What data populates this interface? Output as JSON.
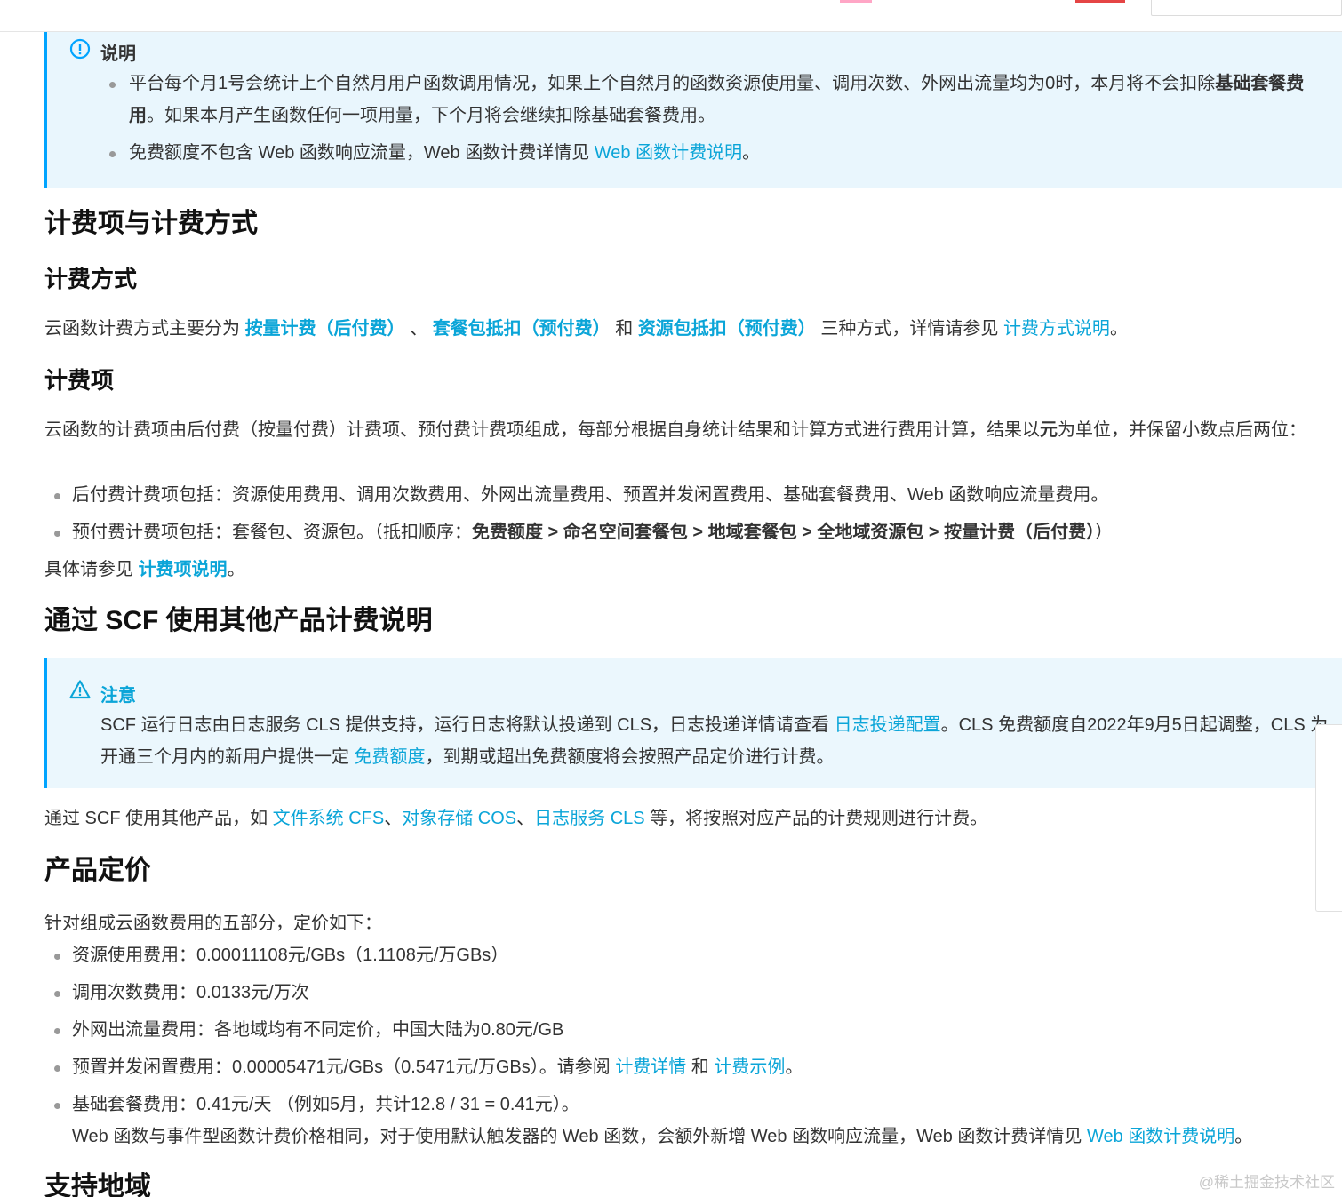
{
  "note": {
    "title": "说明",
    "item1": {
      "pre": "平台每个月1号会统计上个自然月用户函数调用情况，如果上个自然月的函数资源使用量、调用次数、外网出流量均为0时，本月将不会扣除",
      "bold": "基础套餐费用",
      "post": "。如果本月产生函数任何一项用量，下个月将会继续扣除基础套餐费用。"
    },
    "item2": {
      "pre": "免费额度不包含 Web 函数响应流量，Web 函数计费详情见 ",
      "link": "Web 函数计费说明",
      "post": "。"
    }
  },
  "section_billing": {
    "title": "计费项与计费方式",
    "method": {
      "title": "计费方式",
      "pre": "云函数计费方式主要分为 ",
      "link1": "按量计费（后付费）",
      "sep1": " 、 ",
      "link2": "套餐包抵扣（预付费）",
      "sep2": " 和 ",
      "link3": "资源包抵扣（预付费）",
      "mid": " 三种方式，详情请参见 ",
      "link4": "计费方式说明",
      "post": "。"
    },
    "items": {
      "title": "计费项",
      "intro_pre": "云函数的计费项由后付费（按量付费）计费项、预付费计费项组成，每部分根据自身统计结果和计算方式进行费用计算，结果以",
      "intro_bold": "元",
      "intro_post": "为单位，并保留小数点后两位：",
      "bullet1": "后付费计费项包括：资源使用费用、调用次数费用、外网出流量费用、预置并发闲置费用、基础套餐费用、Web 函数响应流量费用。",
      "bullet2_pre": "预付费计费项包括：套餐包、资源包。（抵扣顺序：",
      "bullet2_bold": "免费额度 > 命名空间套餐包 > 地域套餐包 > 全地域资源包 > 按量计费（后付费）",
      "bullet2_post": "）",
      "ref_pre": "具体请参见 ",
      "ref_link": "计费项说明",
      "ref_post": "。"
    }
  },
  "section_other": {
    "title": "通过 SCF 使用其他产品计费说明",
    "warn_title": "注意",
    "warn_pre": "SCF 运行日志由日志服务 CLS 提供支持，运行日志将默认投递到 CLS，日志投递详情请查看 ",
    "warn_link1": "日志投递配置",
    "warn_mid": "。CLS 免费额度自2022年9月5日起调整，CLS 为开通三个月内的新用户提供一定 ",
    "warn_link2": "免费额度",
    "warn_post": "，到期或超出免费额度将会按照产品定价进行计费。",
    "p_pre": "通过 SCF 使用其他产品，如 ",
    "p_link1": "文件系统 CFS",
    "p_sep1": "、",
    "p_link2": "对象存储 COS",
    "p_sep2": "、",
    "p_link3": "日志服务 CLS",
    "p_post": " 等，将按照对应产品的计费规则进行计费。"
  },
  "section_pricing": {
    "title": "产品定价",
    "intro": "针对组成云函数费用的五部分，定价如下：",
    "b1": "资源使用费用：0.00011108元/GBs（1.1108元/万GBs）",
    "b2": "调用次数费用：0.0133元/万次",
    "b3": "外网出流量费用：各地域均有不同定价，中国大陆为0.80元/GB",
    "b4_pre": "预置并发闲置费用：0.00005471元/GBs（0.5471元/万GBs）。请参阅 ",
    "b4_link1": "计费详情",
    "b4_mid": " 和 ",
    "b4_link2": "计费示例",
    "b4_post": "。",
    "b5": "基础套餐费用：0.41元/天 （例如5月，共计12.8 / 31 = 0.41元）。",
    "b5_extra_pre": "Web 函数与事件型函数计费价格相同，对于使用默认触发器的 Web 函数，会额外新增 Web 函数响应流量，Web 函数计费详情见 ",
    "b5_extra_link": "Web 函数计费说明",
    "b5_extra_post": "。"
  },
  "section_regions": {
    "title": "支持地域"
  },
  "watermark": "@稀土掘金技术社区",
  "colors": {
    "link": "#0ba5d8",
    "callout_bg": "#e9f6fd",
    "callout_border": "#00a4ff"
  }
}
